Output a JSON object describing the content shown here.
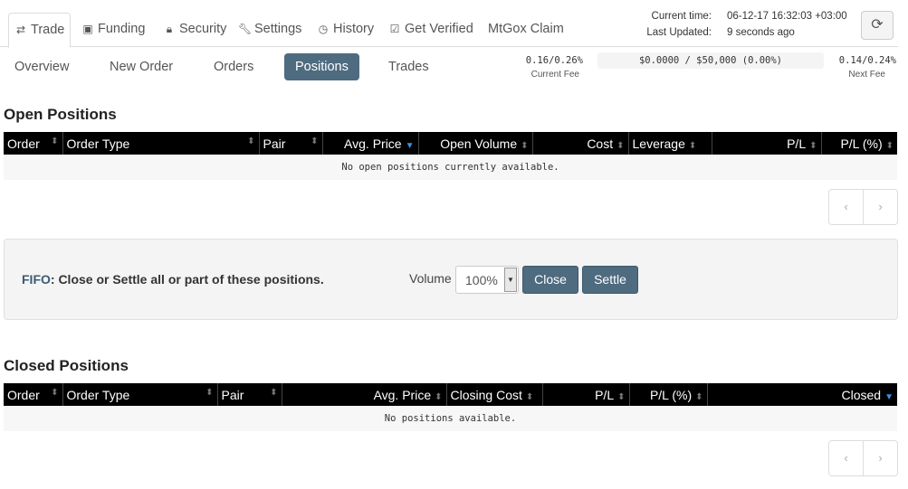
{
  "top_tabs": [
    {
      "label": "Trade",
      "icon": "retweet-icon",
      "active": true
    },
    {
      "label": "Funding",
      "icon": "money-icon"
    },
    {
      "label": "Security",
      "icon": "lock-icon"
    },
    {
      "label": "Settings",
      "icon": "wrench-icon"
    },
    {
      "label": "History",
      "icon": "clock-icon"
    },
    {
      "label": "Get Verified",
      "icon": "check-square-icon"
    },
    {
      "label": "MtGox Claim"
    }
  ],
  "status": {
    "current_time_label": "Current time:",
    "current_time": "06-12-17 16:32:03 +03:00",
    "last_updated_label": "Last Updated:",
    "last_updated": "9 seconds ago",
    "refresh_icon": "refresh-icon"
  },
  "sub_tabs": [
    {
      "label": "Overview"
    },
    {
      "label": "New Order"
    },
    {
      "label": "Orders"
    },
    {
      "label": "Positions",
      "active": true
    },
    {
      "label": "Trades"
    }
  ],
  "fees": {
    "current": "0.16/0.26%",
    "current_label": "Current Fee",
    "volume": "$0.0000 / $50,000 (0.00%)",
    "next": "0.14/0.24%",
    "next_label": "Next Fee"
  },
  "open_positions": {
    "title": "Open Positions",
    "columns": [
      "Order",
      "Order Type",
      "Pair",
      "Avg. Price",
      "Open Volume",
      "Cost",
      "Leverage",
      "P/L",
      "P/L (%)"
    ],
    "empty": "No open positions currently available.",
    "sorted_column": "Avg. Price"
  },
  "fifo": {
    "label": "FIFO",
    "text": ": Close or Settle all or part of these positions.",
    "volume_label": "Volume",
    "volume_value": "100%",
    "close": "Close",
    "settle": "Settle",
    "accent": "#3b5a78"
  },
  "closed_positions": {
    "title": "Closed Positions",
    "columns": [
      "Order",
      "Order Type",
      "Pair",
      "Avg. Price",
      "Closing Cost",
      "P/L",
      "P/L (%)",
      "Closed"
    ],
    "empty": "No positions available.",
    "sorted_column": "Closed"
  },
  "pager": {
    "prev": "‹",
    "next": "›"
  }
}
